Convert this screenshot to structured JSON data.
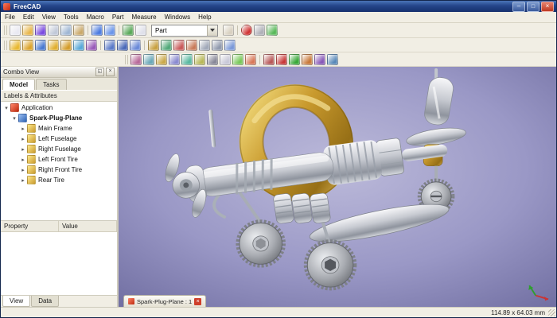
{
  "window": {
    "title": "FreeCAD"
  },
  "menu": {
    "items": [
      "File",
      "Edit",
      "View",
      "Tools",
      "Macro",
      "Part",
      "Measure",
      "Windows",
      "Help"
    ]
  },
  "toolbars": {
    "workbench_selected": "Part",
    "standard": [
      {
        "name": "new-document",
        "color": "#e9e9f2"
      },
      {
        "name": "open-document",
        "color": "#e8b64a"
      },
      {
        "name": "save-document",
        "color": "#7a4ae0"
      },
      {
        "name": "cut",
        "color": "#c0c8d8"
      },
      {
        "name": "copy",
        "color": "#9fb6d4"
      },
      {
        "name": "paste",
        "color": "#caa96a"
      },
      {
        "sep": true
      },
      {
        "name": "undo",
        "color": "#4a7ae0"
      },
      {
        "name": "redo",
        "color": "#6a95ea"
      },
      {
        "sep": true
      },
      {
        "name": "refresh",
        "color": "#58a858"
      },
      {
        "name": "whats-this",
        "color": "#dfe0ea"
      }
    ],
    "macro": [
      {
        "name": "open-website",
        "color": "#d8d0c0"
      },
      {
        "sep": true
      },
      {
        "name": "record-macro",
        "color": "#d03030",
        "shape": "dot"
      },
      {
        "name": "macros-dialog",
        "color": "#b0b0b8"
      },
      {
        "name": "execute-macro",
        "color": "#58b858"
      }
    ],
    "part_primitives": [
      {
        "name": "box",
        "color": "#e8b830"
      },
      {
        "name": "cylinder",
        "color": "#dca42c"
      },
      {
        "name": "sphere",
        "color": "#4878d0"
      },
      {
        "name": "cone",
        "color": "#e0ae2e"
      },
      {
        "name": "torus",
        "color": "#d49c2a"
      },
      {
        "name": "create-primitives",
        "color": "#58a8d8"
      },
      {
        "name": "shape-builder",
        "color": "#9858b8"
      },
      {
        "sep": true
      },
      {
        "name": "boolean-union",
        "color": "#5878c8"
      },
      {
        "name": "boolean-common",
        "color": "#4868b8"
      },
      {
        "name": "boolean-cut",
        "color": "#6888d8"
      },
      {
        "sep": true
      },
      {
        "name": "extrude",
        "color": "#c8a040"
      },
      {
        "name": "revolve",
        "color": "#50a878"
      },
      {
        "name": "section",
        "color": "#c85858"
      },
      {
        "name": "cross-sections",
        "color": "#c87a58"
      },
      {
        "name": "chamfer",
        "color": "#a0a8b8"
      },
      {
        "name": "fillet",
        "color": "#8f98ac"
      },
      {
        "name": "mirror",
        "color": "#7a98d8"
      }
    ],
    "part_tools": [
      {
        "name": "sweep",
        "color": "#b86a9a"
      },
      {
        "name": "loft",
        "color": "#6aa8b8"
      },
      {
        "name": "offset",
        "color": "#caa84a"
      },
      {
        "name": "thickness",
        "color": "#8a8ad0"
      },
      {
        "name": "ruled-surface",
        "color": "#58b8a0"
      },
      {
        "name": "shape-from-mesh",
        "color": "#b8b858"
      },
      {
        "name": "convert-to-solid",
        "color": "#888898"
      },
      {
        "name": "reverse-shapes",
        "color": "#c8c8d8"
      },
      {
        "name": "refine-shape",
        "color": "#78c858"
      },
      {
        "name": "check-geometry",
        "color": "#d87858"
      },
      {
        "sep": true
      },
      {
        "name": "defeaturing",
        "color": "#b85858"
      },
      {
        "name": "measure-linear",
        "color": "#c83838"
      },
      {
        "name": "measure-angular",
        "color": "#38a838"
      },
      {
        "name": "clear-measurement",
        "color": "#c87838"
      },
      {
        "name": "toggle-3d-annotation",
        "color": "#8858b8"
      },
      {
        "name": "toggle-delta-annotation",
        "color": "#5888b8"
      }
    ]
  },
  "combo_view": {
    "title": "Combo View",
    "tabs": [
      "Model",
      "Tasks"
    ],
    "tree_header": "Labels & Attributes",
    "tree": {
      "root_label": "Application",
      "document_label": "Spark-Plug-Plane",
      "children": [
        {
          "label": "Main Frame"
        },
        {
          "label": "Left Fuselage"
        },
        {
          "label": "Right Fuselage"
        },
        {
          "label": "Left Front Tire"
        },
        {
          "label": "Right Front Tire"
        },
        {
          "label": "Rear Tire"
        }
      ]
    },
    "property_table": {
      "columns": [
        "Property",
        "Value"
      ]
    },
    "bottom_tabs": [
      "View",
      "Data"
    ]
  },
  "viewport": {
    "document_tab": "Spark-Plug-Plane : 1",
    "background_center": "#bcbada",
    "background_edge": "#6f6da0",
    "model_gold": "#c99a2e",
    "model_silver": "#c7cad1"
  },
  "status_bar": {
    "dimension_readout": "114.89 x 64.03 mm"
  }
}
